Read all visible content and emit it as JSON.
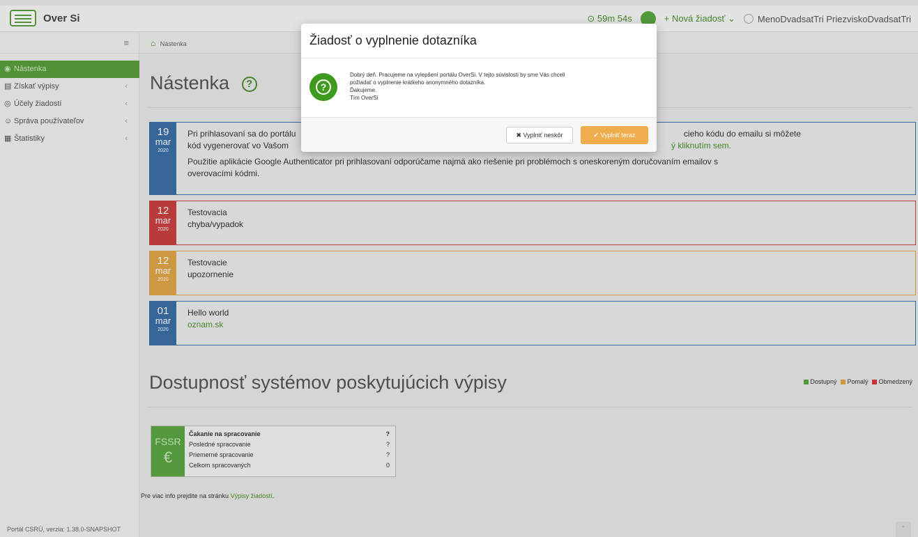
{
  "app": {
    "logo_text": "Over Si"
  },
  "topbar": {
    "timer": "⊙ 59m 54s",
    "new_request": "+ Nová žiadosť ⌄",
    "user_name": "MenoDvadsatTri PriezviskoDvadsatTri"
  },
  "sidebar": {
    "toggle": "≡",
    "items": [
      {
        "label": "Nástenka",
        "icon": "dashboard-icon",
        "icon_glyph": "◉",
        "has_chevron": false
      },
      {
        "label": "Získať výpisy",
        "icon": "documents-icon",
        "icon_glyph": "▤",
        "has_chevron": true
      },
      {
        "label": "Účely žiadostí",
        "icon": "target-icon",
        "icon_glyph": "◎",
        "has_chevron": true
      },
      {
        "label": "Správa používateľov",
        "icon": "users-icon",
        "icon_glyph": "☺",
        "has_chevron": true
      },
      {
        "label": "Štatistiky",
        "icon": "chart-icon",
        "icon_glyph": "▦",
        "has_chevron": true
      }
    ],
    "chevron": "‹",
    "version": "Portál CSRÚ, verzia: 1.38.0-SNAPSHOT"
  },
  "breadcrumb": {
    "icon_glyph": "⌂",
    "label": "Nástenka"
  },
  "page": {
    "title": "Nástenka",
    "help_glyph": "?"
  },
  "notices": [
    {
      "day": "19",
      "month": "mar",
      "year": "2020",
      "color": "#3b6ea5",
      "line1": "Pri prihlasovaní sa do portálu",
      "line1_tail": "cieho kódu do emailu si môžete",
      "line2": "kód vygenerovať vo Vašom",
      "line2_link": "ý kliknutím sem.",
      "line3": "Použitie aplikácie Google Authenticator pri prihlasovaní odporúčame najmä ako riešenie pri problémoch s oneskoreným doručovaním emailov s",
      "line4": "overovacími kódmi."
    },
    {
      "day": "12",
      "month": "mar",
      "year": "2020",
      "color": "#c94141",
      "line1": "Testovacia",
      "line2": "chyba/vypadok"
    },
    {
      "day": "12",
      "month": "mar",
      "year": "2020",
      "color": "#e0a548",
      "line1": "Testovacie",
      "line2": "upozornenie"
    },
    {
      "day": "01",
      "month": "mar",
      "year": "2020",
      "color": "#3b6ea5",
      "line1": "Hello world",
      "line2_link": "oznam.sk"
    }
  ],
  "availability": {
    "title": "Dostupnosť systémov poskytujúcich výpisy",
    "legend": [
      {
        "label": "Dostupný",
        "color": "#5aa640"
      },
      {
        "label": "Pomalý",
        "color": "#e0a548"
      },
      {
        "label": "Obmedzený",
        "color": "#d9363e"
      }
    ],
    "system": {
      "name": "FSSR",
      "symbol": "€",
      "rows": [
        {
          "label": "Čakanie na spracovanie",
          "value": "?"
        },
        {
          "label": "Posledné spracovanie",
          "value": "?"
        },
        {
          "label": "Priemerné spracovanie",
          "value": "?"
        },
        {
          "label": "Celkom spracovaných",
          "value": "0"
        }
      ]
    },
    "more_info_prefix": "Pre viac info prejdite na stránku",
    "more_info_link": "Výpisy žiadostí",
    "more_info_suffix": "."
  },
  "modal": {
    "title": "Žiadosť o vyplnenie dotazníka",
    "body_line1": "Dobrý deň. Pracujeme na vylepšení portálu OverSi. V tejto súvislosti by sme Vás chceli",
    "body_line2": "požiadať o vyplnenie krátkeho anonymného dotazníka.",
    "body_line3": "Ďakujeme.",
    "body_line4": "Tím OverSi",
    "btn_later": "✖ Vyplniť neskôr",
    "btn_now": "✔ Vyplniť teraz"
  },
  "back_to_top": "⌃"
}
